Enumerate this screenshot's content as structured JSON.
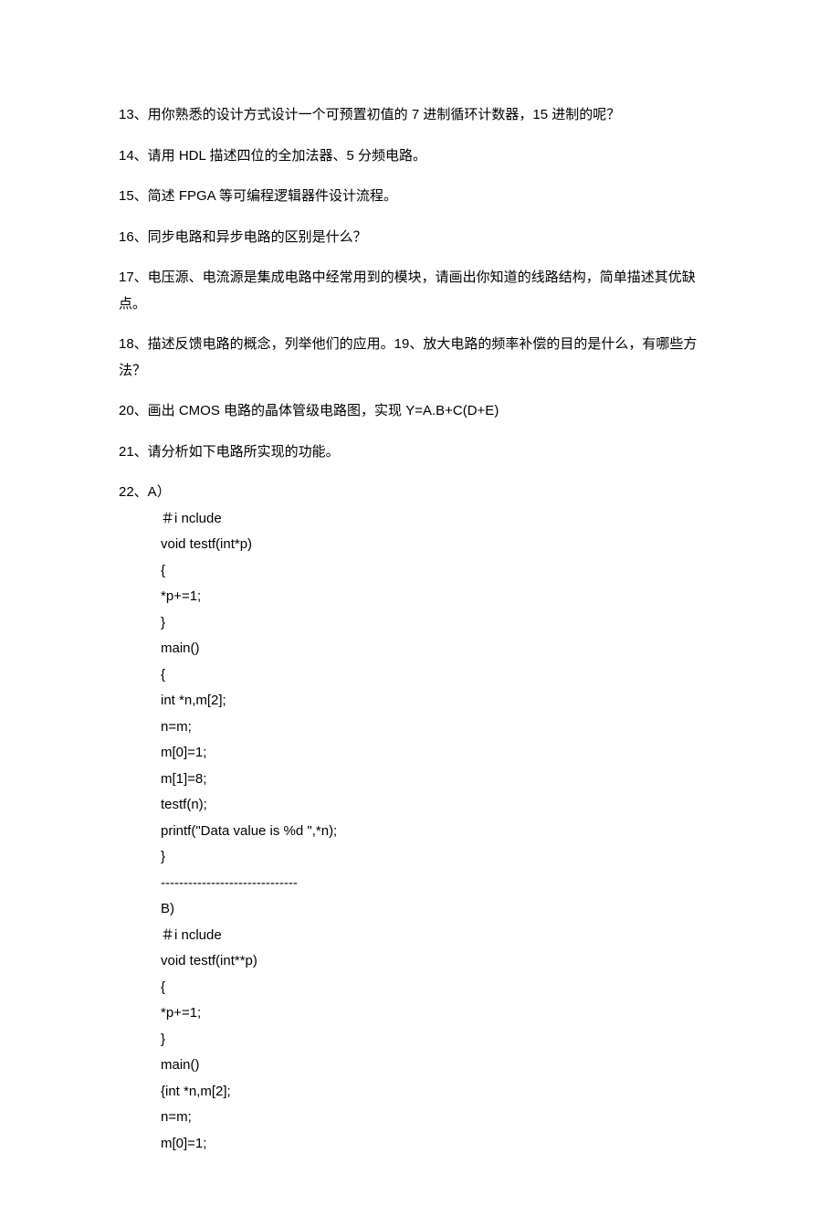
{
  "paragraphs": [
    "13、用你熟悉的设计方式设计一个可预置初值的 7 进制循环计数器，15 进制的呢？",
    "14、请用 HDL 描述四位的全加法器、5 分频电路。",
    "15、简述 FPGA 等可编程逻辑器件设计流程。",
    "16、同步电路和异步电路的区别是什么？",
    "17、电压源、电流源是集成电路中经常用到的模块，请画出你知道的线路结构，简单描述其优缺点。",
    "18、描述反馈电路的概念，列举他们的应用。19、放大电路的频率补偿的目的是什么，有哪些方法？",
    "20、画出 CMOS 电路的晶体管级电路图，实现 Y=A.B+C(D+E)",
    "21、请分析如下电路所实现的功能。"
  ],
  "codeFirst": "22、A）",
  "codeLines": [
    "＃i nclude",
    "void testf(int*p)",
    "{",
    "*p+=1;",
    "}",
    "main()",
    "{",
    "int *n,m[2];",
    "n=m;",
    "m[0]=1;",
    "m[1]=8;",
    "testf(n);",
    "printf(\"Data value is %d \",*n);",
    "}",
    "------------------------------",
    "B)",
    "＃i nclude",
    "void testf(int**p)",
    "{",
    "*p+=1;",
    "}",
    "main()",
    "{int *n,m[2];",
    "n=m;",
    "m[0]=1;"
  ]
}
